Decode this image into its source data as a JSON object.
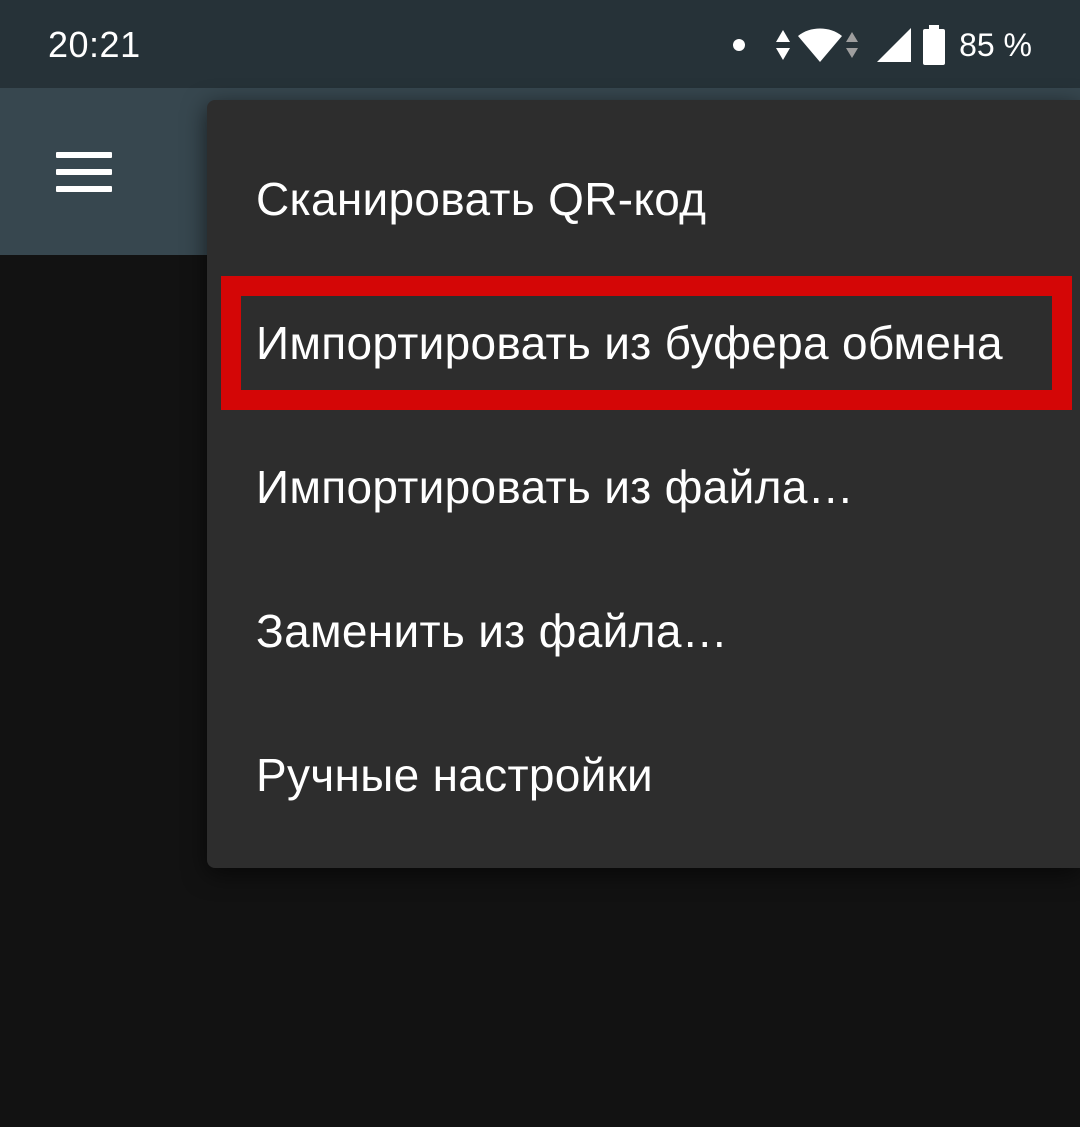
{
  "status_bar": {
    "time": "20:21",
    "battery_percent": "85 %",
    "icons": [
      "notification-dot-icon",
      "data-activity-icon",
      "wifi-icon",
      "wifi-activity-icon",
      "cellular-signal-icon",
      "battery-icon"
    ]
  },
  "app_bar": {
    "menu_icon": "hamburger-menu-icon"
  },
  "menu": {
    "items": [
      {
        "label": "Сканировать QR-код"
      },
      {
        "label": "Импортировать из буфера обмена"
      },
      {
        "label": "Импортировать из файла…"
      },
      {
        "label": "Заменить из файла…"
      },
      {
        "label": "Ручные настройки"
      }
    ],
    "highlighted_index": 1
  },
  "colors": {
    "status_bar": "#263238",
    "app_bar": "#37474f",
    "menu_background": "#2d2d2d",
    "screen_background": "#121212",
    "highlight": "#d40606",
    "text": "#ffffff"
  }
}
